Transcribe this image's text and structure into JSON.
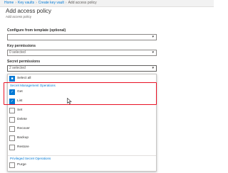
{
  "breadcrumb": [
    "Home",
    "Key vaults",
    "Create key vault",
    "Add access policy"
  ],
  "page": {
    "title": "Add access policy",
    "subtitle": "Add access policy"
  },
  "template": {
    "label": "Configure from template (optional)",
    "value": ""
  },
  "key_permissions": {
    "label": "Key permissions",
    "value": "0 selected"
  },
  "secret_permissions": {
    "label": "Secret permissions",
    "value": "2 selected",
    "select_all_label": "Select all",
    "management_header": "Secret Management Operations",
    "management_items": [
      {
        "label": "Get",
        "checked": true
      },
      {
        "label": "List",
        "checked": true
      },
      {
        "label": "Set",
        "checked": false
      },
      {
        "label": "Delete",
        "checked": false
      },
      {
        "label": "Recover",
        "checked": false
      },
      {
        "label": "Backup",
        "checked": false
      },
      {
        "label": "Restore",
        "checked": false
      }
    ],
    "privileged_header": "Privileged Secret Operations",
    "privileged_items": [
      {
        "label": "Purge",
        "checked": false
      }
    ]
  },
  "colors": {
    "accent": "#0078d4",
    "highlight": "#e81123"
  },
  "icons": {
    "dropdown": "chevron-down-icon",
    "checkmark": "checkmark-icon",
    "cursor": "mouse-pointer-icon"
  }
}
